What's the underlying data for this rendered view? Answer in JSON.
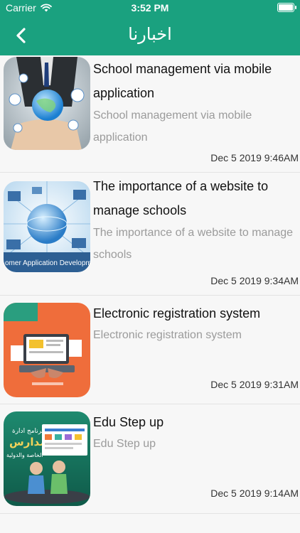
{
  "status_bar": {
    "carrier": "Carrier",
    "time": "3:52 PM"
  },
  "navbar": {
    "title": "اخبارنا"
  },
  "news": [
    {
      "title": "School management via mobile application",
      "subtitle": "School management via mobile application",
      "date": "Dec  5 2019  9:46AM"
    },
    {
      "title": "The importance of a website to manage schools",
      "subtitle": "The importance of a website to manage schools",
      "date": "Dec  5 2019  9:34AM"
    },
    {
      "title": "Electronic registration system",
      "subtitle": "Electronic registration system",
      "date": "Dec  5 2019  9:31AM"
    },
    {
      "title": "Edu Step up",
      "subtitle": "Edu Step up",
      "date": "Dec  5 2019  9:14AM"
    }
  ],
  "thumb_text": {
    "app_dev": "omer Application Developm",
    "edu_line1": "برنامج ادارة",
    "edu_line2": "المدارس",
    "edu_line3": "الخاصة والدولية"
  },
  "colors": {
    "header": "#1aa17f",
    "title_text": "#111111",
    "subtitle_text": "#9b9b9b"
  },
  "icons": [
    "wifi-icon",
    "battery-icon",
    "back-chevron-icon"
  ]
}
